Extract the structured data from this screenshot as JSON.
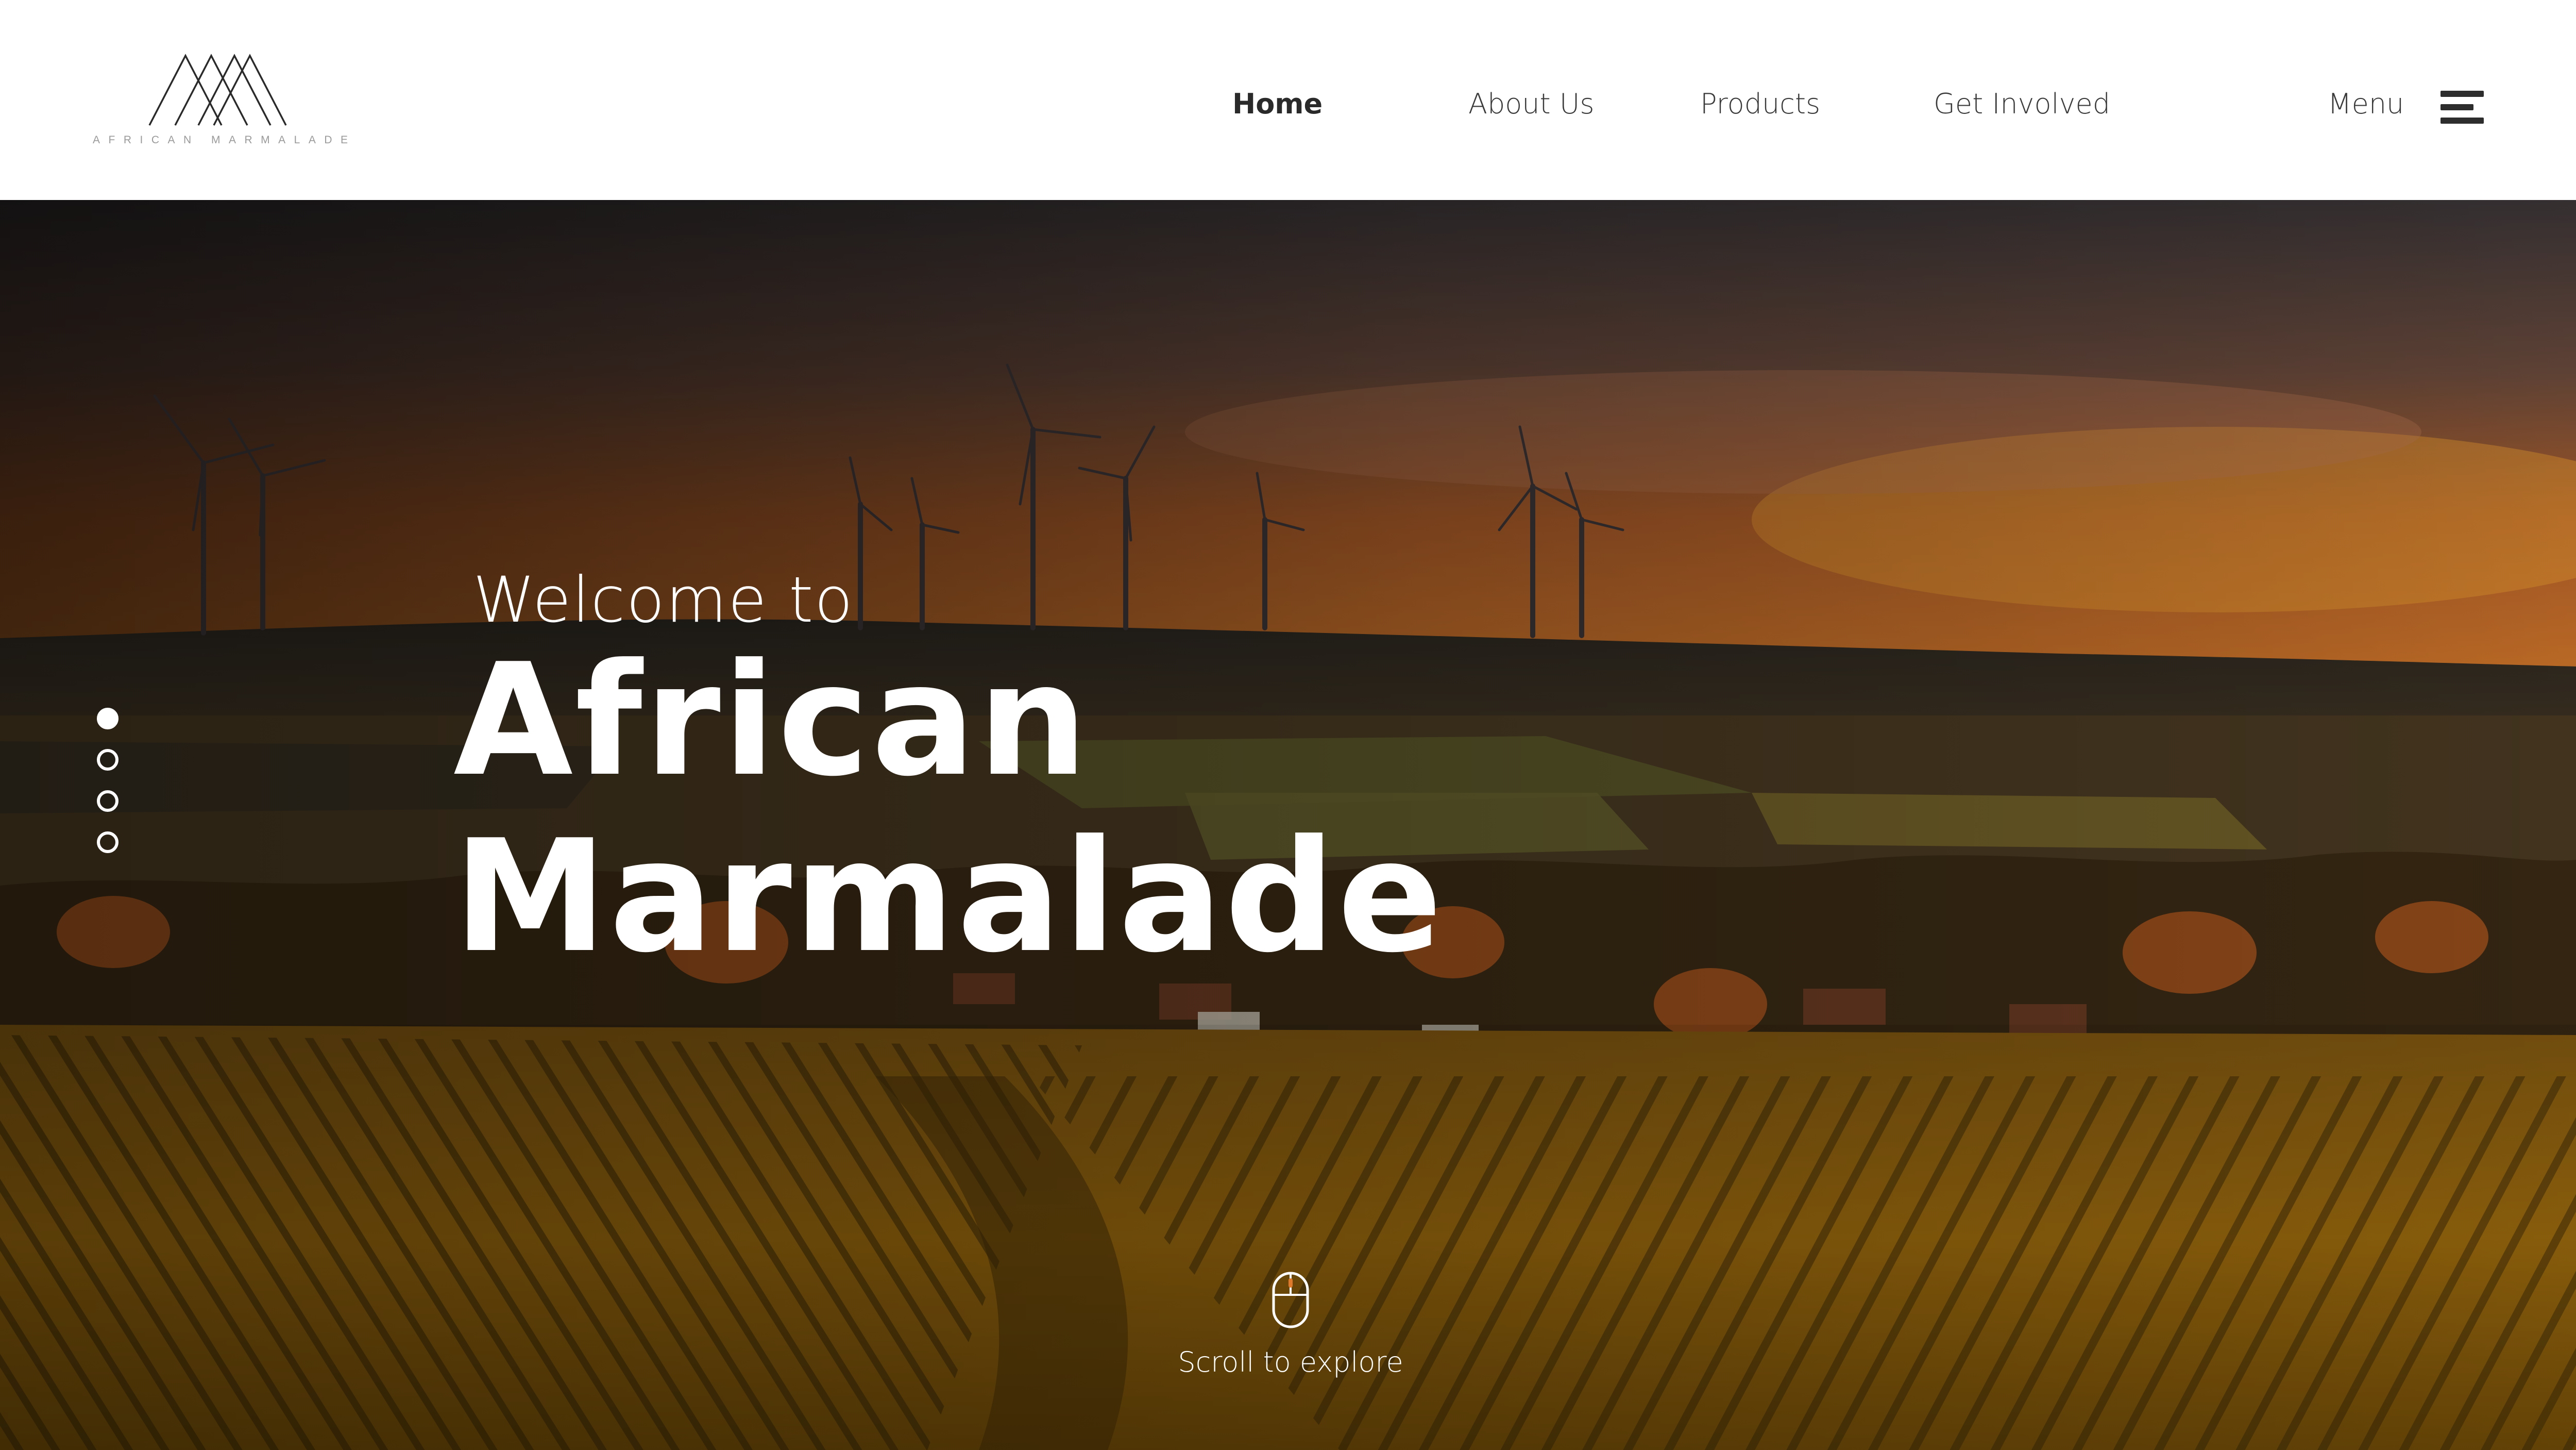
{
  "header": {
    "logo": {
      "name": "mountain-logo-icon",
      "text": "AFRICAN MARMALADE"
    },
    "nav": [
      {
        "label": "Home",
        "active": true
      },
      {
        "label": "About Us",
        "active": false
      },
      {
        "label": "Products",
        "active": false
      },
      {
        "label": "Get Involved",
        "active": false
      }
    ],
    "menu": {
      "label": "Menu",
      "icon": "hamburger-icon"
    }
  },
  "hero": {
    "welcome": "Welcome to",
    "title_line1": "African",
    "title_line2": "Marmalade",
    "slides": {
      "count": 4,
      "active_index": 0
    },
    "scroll_hint": {
      "label": "Scroll to explore",
      "icon": "mouse-scroll-icon"
    },
    "background": "sunset-vineyard-wind-turbines"
  },
  "colors": {
    "header_bg": "#ffffff",
    "nav_text": "#3a3a3a",
    "hero_text": "#ffffff",
    "sky_orange": "#e07a2a",
    "field_gold": "#b07a10"
  }
}
